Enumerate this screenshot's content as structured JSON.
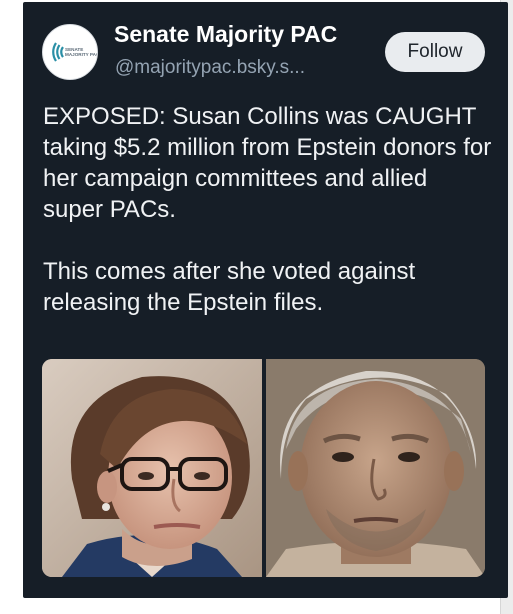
{
  "post": {
    "author": {
      "display_name": "Senate Majority PAC",
      "handle": "@majoritypac.bsky.s...",
      "avatar_text": "SENATE MAJORITY PAC"
    },
    "follow_label": "Follow",
    "paragraphs": [
      "EXPOSED: Susan Collins was CAUGHT taking $5.2 million from Epstein donors for her campaign committees and allied super PACs.",
      "This comes after she voted against releasing the Epstein files."
    ],
    "images": [
      {
        "subject": "woman-with-glasses-portrait"
      },
      {
        "subject": "man-mugshot-portrait"
      }
    ]
  },
  "colors": {
    "card_background": "#161e27",
    "text_primary": "#f0f2f4",
    "text_secondary": "#94a3b2",
    "follow_button_bg": "#e9ecef",
    "avatar_accent": "#2a8fa6"
  }
}
